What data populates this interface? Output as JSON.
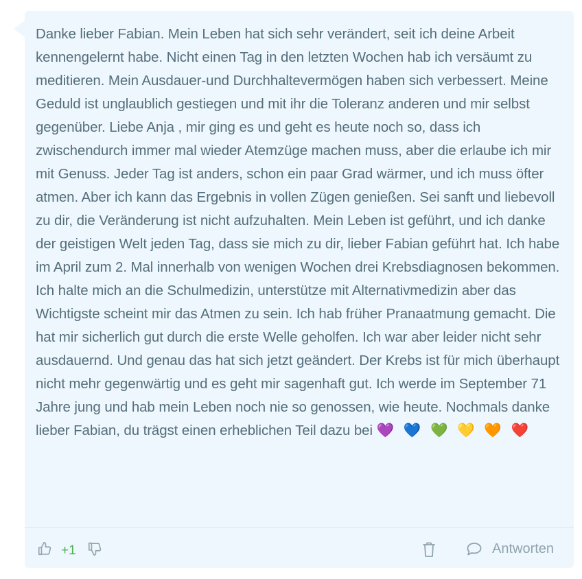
{
  "comment": {
    "text": "Danke lieber Fabian. Mein Leben hat sich sehr verändert, seit ich deine Arbeit kennengelernt habe. Nicht einen Tag in den letzten Wochen hab ich versäumt zu meditieren. Mein Ausdauer-und Durchhaltevermögen haben sich verbessert. Meine Geduld ist unglaublich gestiegen und mit ihr die Toleranz anderen und mir selbst gegenüber. Liebe Anja , mir ging es und geht es heute noch so, dass ich zwischendurch immer mal wieder Atemzüge machen muss, aber die erlaube ich mir mit Genuss. Jeder Tag ist anders, schon ein paar Grad wärmer, und ich muss öfter atmen. Aber ich kann das Ergebnis in vollen Zügen genießen. Sei sanft und liebevoll zu dir, die Veränderung ist nicht aufzuhalten. Mein Leben ist geführt, und ich danke der geistigen Welt jeden Tag, dass sie mich zu dir, lieber Fabian geführt hat. Ich habe im April zum 2. Mal innerhalb von wenigen Wochen drei Krebsdiagnosen bekommen. Ich halte mich an die Schulmedizin, unterstütze mit Alternativmedizin aber das Wichtigste scheint mir das Atmen zu sein. Ich hab früher Pranaatmung gemacht. Die hat mir sicherlich gut durch die erste Welle geholfen. Ich war aber leider nicht sehr ausdauernd. Und genau das hat sich jetzt geändert. Der Krebs ist für mich überhaupt nicht mehr gegenwärtig und es geht mir sagenhaft gut. Ich werde im September 71 Jahre jung und hab mein Leben noch nie so genossen, wie heute. Nochmals danke lieber Fabian, du trägst einen erheblichen Teil dazu bei ",
    "hearts": "💜 💙 💚 💛 🧡 ❤️"
  },
  "actions": {
    "vote_count": "+1",
    "reply_label": "Antworten",
    "icons": {
      "upvote": "thumbs-up-icon",
      "downvote": "thumbs-down-icon",
      "delete": "trash-icon",
      "reply": "speech-bubble-icon"
    }
  },
  "colors": {
    "card_background": "#eef7fd",
    "text": "#546e7a",
    "icon": "#90a4ae",
    "vote_positive": "#4caf50"
  }
}
